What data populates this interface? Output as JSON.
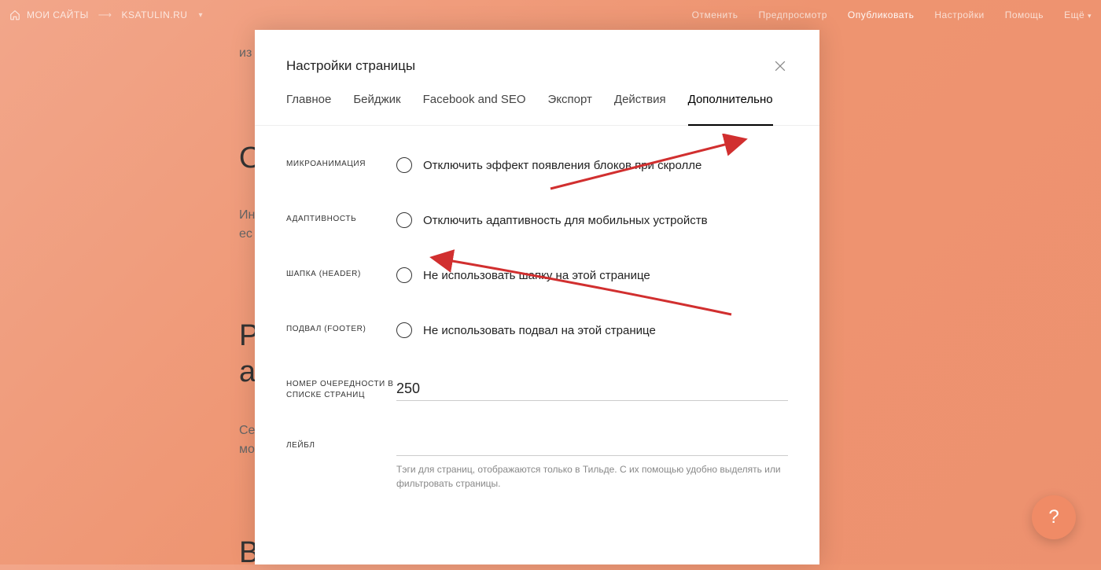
{
  "topbar": {
    "my_sites_label": "МОИ САЙТЫ",
    "site_name": "KSATULIN.RU",
    "links": {
      "cancel": "Отменить",
      "preview": "Предпросмотр",
      "publish": "Опубликовать",
      "settings": "Настройки",
      "help": "Помощь",
      "more": "Ещё"
    }
  },
  "background": {
    "line1": "из",
    "heading1": "О",
    "para1a": "Ин",
    "para1b": "ес",
    "heading2a": "Ра",
    "heading2b": "ад",
    "para2a": "Се",
    "para2b": "мо",
    "heading3": "В"
  },
  "modal": {
    "title": "Настройки страницы",
    "tabs": {
      "main": "Главное",
      "badge": "Бейджик",
      "seo": "Facebook and SEO",
      "export": "Экспорт",
      "actions": "Действия",
      "additional": "Дополнительно"
    },
    "settings": {
      "microanimation": {
        "label": "МИКРОАНИМАЦИЯ",
        "option": "Отключить эффект появления блоков при скролле"
      },
      "adaptivity": {
        "label": "АДАПТИВНОСТЬ",
        "option": "Отключить адаптивность для мобильных устройств"
      },
      "header": {
        "label": "ШАПКА (HEADER)",
        "option": "Не использовать шапку на этой странице"
      },
      "footer": {
        "label": "ПОДВАЛ (FOOTER)",
        "option": "Не использовать подвал на этой странице"
      },
      "order": {
        "label": "НОМЕР ОЧЕРЕДНОСТИ В СПИСКЕ СТРАНИЦ",
        "value": "250"
      },
      "label_field": {
        "label": "ЛЕЙБЛ",
        "value": "",
        "hint": "Тэги для страниц, отображаются только в Тильде. С их помощью удобно выделять или фильтровать страницы."
      }
    }
  },
  "help_button": "?"
}
